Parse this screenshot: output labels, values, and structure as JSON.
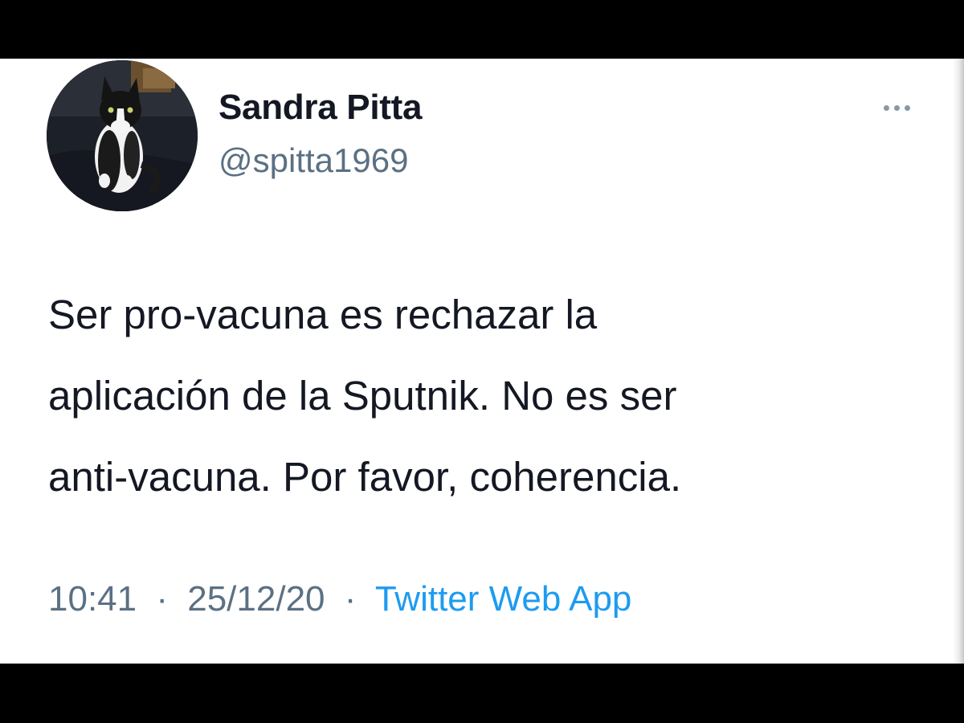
{
  "tweet": {
    "author": {
      "display_name": "Sandra Pitta",
      "handle": "@spitta1969",
      "avatar_icon": "cat-photo-avatar"
    },
    "text_lines": [
      "Ser pro-vacuna es rechazar la",
      "aplicación de la Sputnik. No es ser",
      "anti-vacuna. Por favor, coherencia."
    ],
    "time": "10:41",
    "date": "25/12/20",
    "separator": "·",
    "source": "Twitter Web App",
    "more_icon": "more-options-icon"
  },
  "colors": {
    "text_primary": "#141823",
    "text_secondary": "#5b7083",
    "link": "#1d9bf0",
    "background": "#ffffff",
    "letterbox": "#000000"
  }
}
